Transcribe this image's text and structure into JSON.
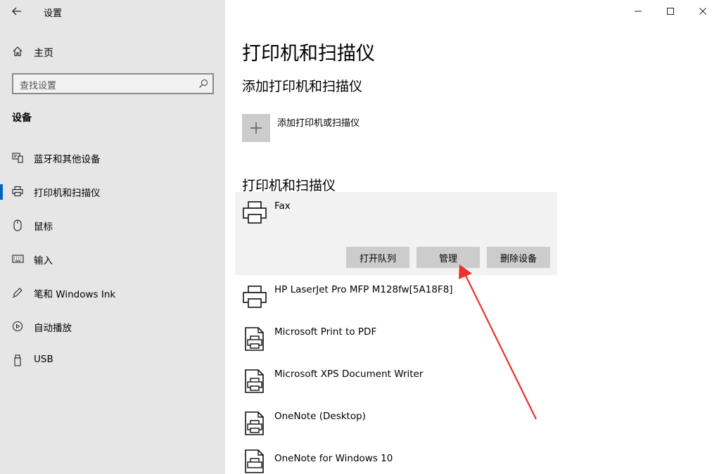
{
  "app": {
    "title": "设置"
  },
  "sidebar": {
    "home_label": "主页",
    "search_placeholder": "查找设置",
    "section": "设备",
    "items": [
      {
        "label": "蓝牙和其他设备",
        "icon": "bluetooth-devices-icon"
      },
      {
        "label": "打印机和扫描仪",
        "icon": "printer-icon",
        "active": true
      },
      {
        "label": "鼠标",
        "icon": "mouse-icon"
      },
      {
        "label": "输入",
        "icon": "keyboard-icon"
      },
      {
        "label": "笔和 Windows Ink",
        "icon": "pen-icon"
      },
      {
        "label": "自动播放",
        "icon": "autoplay-icon"
      },
      {
        "label": "USB",
        "icon": "usb-icon"
      }
    ]
  },
  "main": {
    "title": "打印机和扫描仪",
    "add_section": "添加打印机和扫描仪",
    "add_label": "添加打印机或扫描仪",
    "list_section": "打印机和扫描仪",
    "devices": [
      {
        "name": "Fax",
        "type": "printer"
      },
      {
        "name": "HP LaserJet Pro MFP M128fw[5A18F8]",
        "type": "printer"
      },
      {
        "name": "Microsoft Print to PDF",
        "type": "document-printer"
      },
      {
        "name": "Microsoft XPS Document Writer",
        "type": "document-printer"
      },
      {
        "name": "OneNote (Desktop)",
        "type": "document-printer"
      },
      {
        "name": "OneNote for Windows 10",
        "type": "document-printer"
      }
    ],
    "actions": {
      "open_queue": "打开队列",
      "manage": "管理",
      "remove": "删除设备"
    }
  },
  "colors": {
    "sidebar_bg": "#e6e6e6",
    "accent": "#0067c0",
    "button_bg": "#cccccc",
    "arrow": "#e8322b"
  }
}
